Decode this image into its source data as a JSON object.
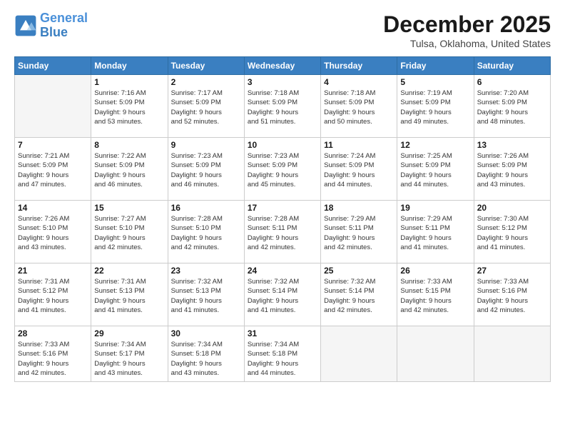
{
  "header": {
    "logo_line1": "General",
    "logo_line2": "Blue",
    "month_title": "December 2025",
    "subtitle": "Tulsa, Oklahoma, United States"
  },
  "days_of_week": [
    "Sunday",
    "Monday",
    "Tuesday",
    "Wednesday",
    "Thursday",
    "Friday",
    "Saturday"
  ],
  "weeks": [
    [
      {
        "day": "",
        "info": ""
      },
      {
        "day": "1",
        "info": "Sunrise: 7:16 AM\nSunset: 5:09 PM\nDaylight: 9 hours\nand 53 minutes."
      },
      {
        "day": "2",
        "info": "Sunrise: 7:17 AM\nSunset: 5:09 PM\nDaylight: 9 hours\nand 52 minutes."
      },
      {
        "day": "3",
        "info": "Sunrise: 7:18 AM\nSunset: 5:09 PM\nDaylight: 9 hours\nand 51 minutes."
      },
      {
        "day": "4",
        "info": "Sunrise: 7:18 AM\nSunset: 5:09 PM\nDaylight: 9 hours\nand 50 minutes."
      },
      {
        "day": "5",
        "info": "Sunrise: 7:19 AM\nSunset: 5:09 PM\nDaylight: 9 hours\nand 49 minutes."
      },
      {
        "day": "6",
        "info": "Sunrise: 7:20 AM\nSunset: 5:09 PM\nDaylight: 9 hours\nand 48 minutes."
      }
    ],
    [
      {
        "day": "7",
        "info": "Sunrise: 7:21 AM\nSunset: 5:09 PM\nDaylight: 9 hours\nand 47 minutes."
      },
      {
        "day": "8",
        "info": "Sunrise: 7:22 AM\nSunset: 5:09 PM\nDaylight: 9 hours\nand 46 minutes."
      },
      {
        "day": "9",
        "info": "Sunrise: 7:23 AM\nSunset: 5:09 PM\nDaylight: 9 hours\nand 46 minutes."
      },
      {
        "day": "10",
        "info": "Sunrise: 7:23 AM\nSunset: 5:09 PM\nDaylight: 9 hours\nand 45 minutes."
      },
      {
        "day": "11",
        "info": "Sunrise: 7:24 AM\nSunset: 5:09 PM\nDaylight: 9 hours\nand 44 minutes."
      },
      {
        "day": "12",
        "info": "Sunrise: 7:25 AM\nSunset: 5:09 PM\nDaylight: 9 hours\nand 44 minutes."
      },
      {
        "day": "13",
        "info": "Sunrise: 7:26 AM\nSunset: 5:09 PM\nDaylight: 9 hours\nand 43 minutes."
      }
    ],
    [
      {
        "day": "14",
        "info": "Sunrise: 7:26 AM\nSunset: 5:10 PM\nDaylight: 9 hours\nand 43 minutes."
      },
      {
        "day": "15",
        "info": "Sunrise: 7:27 AM\nSunset: 5:10 PM\nDaylight: 9 hours\nand 42 minutes."
      },
      {
        "day": "16",
        "info": "Sunrise: 7:28 AM\nSunset: 5:10 PM\nDaylight: 9 hours\nand 42 minutes."
      },
      {
        "day": "17",
        "info": "Sunrise: 7:28 AM\nSunset: 5:11 PM\nDaylight: 9 hours\nand 42 minutes."
      },
      {
        "day": "18",
        "info": "Sunrise: 7:29 AM\nSunset: 5:11 PM\nDaylight: 9 hours\nand 42 minutes."
      },
      {
        "day": "19",
        "info": "Sunrise: 7:29 AM\nSunset: 5:11 PM\nDaylight: 9 hours\nand 41 minutes."
      },
      {
        "day": "20",
        "info": "Sunrise: 7:30 AM\nSunset: 5:12 PM\nDaylight: 9 hours\nand 41 minutes."
      }
    ],
    [
      {
        "day": "21",
        "info": "Sunrise: 7:31 AM\nSunset: 5:12 PM\nDaylight: 9 hours\nand 41 minutes."
      },
      {
        "day": "22",
        "info": "Sunrise: 7:31 AM\nSunset: 5:13 PM\nDaylight: 9 hours\nand 41 minutes."
      },
      {
        "day": "23",
        "info": "Sunrise: 7:32 AM\nSunset: 5:13 PM\nDaylight: 9 hours\nand 41 minutes."
      },
      {
        "day": "24",
        "info": "Sunrise: 7:32 AM\nSunset: 5:14 PM\nDaylight: 9 hours\nand 41 minutes."
      },
      {
        "day": "25",
        "info": "Sunrise: 7:32 AM\nSunset: 5:14 PM\nDaylight: 9 hours\nand 42 minutes."
      },
      {
        "day": "26",
        "info": "Sunrise: 7:33 AM\nSunset: 5:15 PM\nDaylight: 9 hours\nand 42 minutes."
      },
      {
        "day": "27",
        "info": "Sunrise: 7:33 AM\nSunset: 5:16 PM\nDaylight: 9 hours\nand 42 minutes."
      }
    ],
    [
      {
        "day": "28",
        "info": "Sunrise: 7:33 AM\nSunset: 5:16 PM\nDaylight: 9 hours\nand 42 minutes."
      },
      {
        "day": "29",
        "info": "Sunrise: 7:34 AM\nSunset: 5:17 PM\nDaylight: 9 hours\nand 43 minutes."
      },
      {
        "day": "30",
        "info": "Sunrise: 7:34 AM\nSunset: 5:18 PM\nDaylight: 9 hours\nand 43 minutes."
      },
      {
        "day": "31",
        "info": "Sunrise: 7:34 AM\nSunset: 5:18 PM\nDaylight: 9 hours\nand 44 minutes."
      },
      {
        "day": "",
        "info": ""
      },
      {
        "day": "",
        "info": ""
      },
      {
        "day": "",
        "info": ""
      }
    ]
  ]
}
